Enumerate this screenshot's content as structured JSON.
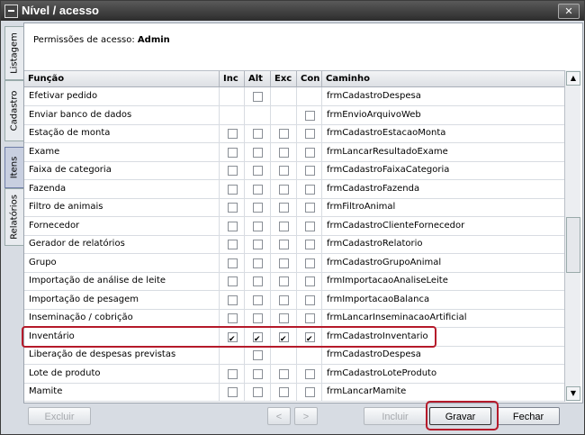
{
  "window": {
    "title": "Nível / acesso",
    "close_glyph": "✕"
  },
  "side_tabs": [
    {
      "label": "Listagem",
      "active": false
    },
    {
      "label": "Cadastro",
      "active": false
    },
    {
      "label": "Itens",
      "active": true
    },
    {
      "label": "Relatórios",
      "active": false
    }
  ],
  "permission": {
    "prefix": "Permissões de acesso:",
    "role": "Admin"
  },
  "table": {
    "columns": [
      "Função",
      "Inc",
      "Alt",
      "Exc",
      "Con",
      "Caminho"
    ],
    "rows": [
      {
        "funcao": "Efetivar pedido",
        "inc": null,
        "alt": false,
        "exc": null,
        "con": null,
        "caminho": "frmCadastroDespesa"
      },
      {
        "funcao": "Enviar banco de dados",
        "inc": null,
        "alt": null,
        "exc": null,
        "con": false,
        "caminho": "frmEnvioArquivoWeb"
      },
      {
        "funcao": "Estação de monta",
        "inc": false,
        "alt": false,
        "exc": false,
        "con": false,
        "caminho": "frmCadastroEstacaoMonta"
      },
      {
        "funcao": "Exame",
        "inc": false,
        "alt": false,
        "exc": false,
        "con": false,
        "caminho": "frmLancarResultadoExame"
      },
      {
        "funcao": "Faixa de categoria",
        "inc": false,
        "alt": false,
        "exc": false,
        "con": false,
        "caminho": "frmCadastroFaixaCategoria"
      },
      {
        "funcao": "Fazenda",
        "inc": false,
        "alt": false,
        "exc": false,
        "con": false,
        "caminho": "frmCadastroFazenda"
      },
      {
        "funcao": "Filtro de animais",
        "inc": false,
        "alt": false,
        "exc": false,
        "con": false,
        "caminho": "frmFiltroAnimal"
      },
      {
        "funcao": "Fornecedor",
        "inc": false,
        "alt": false,
        "exc": false,
        "con": false,
        "caminho": "frmCadastroClienteFornecedor"
      },
      {
        "funcao": "Gerador de relatórios",
        "inc": false,
        "alt": false,
        "exc": false,
        "con": false,
        "caminho": "frmCadastroRelatorio"
      },
      {
        "funcao": "Grupo",
        "inc": false,
        "alt": false,
        "exc": false,
        "con": false,
        "caminho": "frmCadastroGrupoAnimal"
      },
      {
        "funcao": "Importação de análise de leite",
        "inc": false,
        "alt": false,
        "exc": false,
        "con": false,
        "caminho": "frmImportacaoAnaliseLeite"
      },
      {
        "funcao": "Importação de pesagem",
        "inc": false,
        "alt": false,
        "exc": false,
        "con": false,
        "caminho": "frmImportacaoBalanca"
      },
      {
        "funcao": "Inseminação / cobrição",
        "inc": false,
        "alt": false,
        "exc": false,
        "con": false,
        "caminho": "frmLancarInseminacaoArtificial"
      },
      {
        "funcao": "Inventário",
        "inc": true,
        "alt": true,
        "exc": true,
        "con": true,
        "caminho": "frmCadastroInventario"
      },
      {
        "funcao": "Liberação de despesas previstas",
        "inc": null,
        "alt": false,
        "exc": null,
        "con": null,
        "caminho": "frmCadastroDespesa"
      },
      {
        "funcao": "Lote de produto",
        "inc": false,
        "alt": false,
        "exc": false,
        "con": false,
        "caminho": "frmCadastroLoteProduto"
      },
      {
        "funcao": "Mamite",
        "inc": false,
        "alt": false,
        "exc": false,
        "con": false,
        "caminho": "frmLancarMamite"
      }
    ]
  },
  "scrollbar": {
    "up": "▲",
    "down": "▼"
  },
  "buttons": {
    "excluir": "Excluir",
    "prev": "<",
    "next": ">",
    "incluir": "Incluir",
    "gravar": "Gravar",
    "fechar": "Fechar"
  }
}
